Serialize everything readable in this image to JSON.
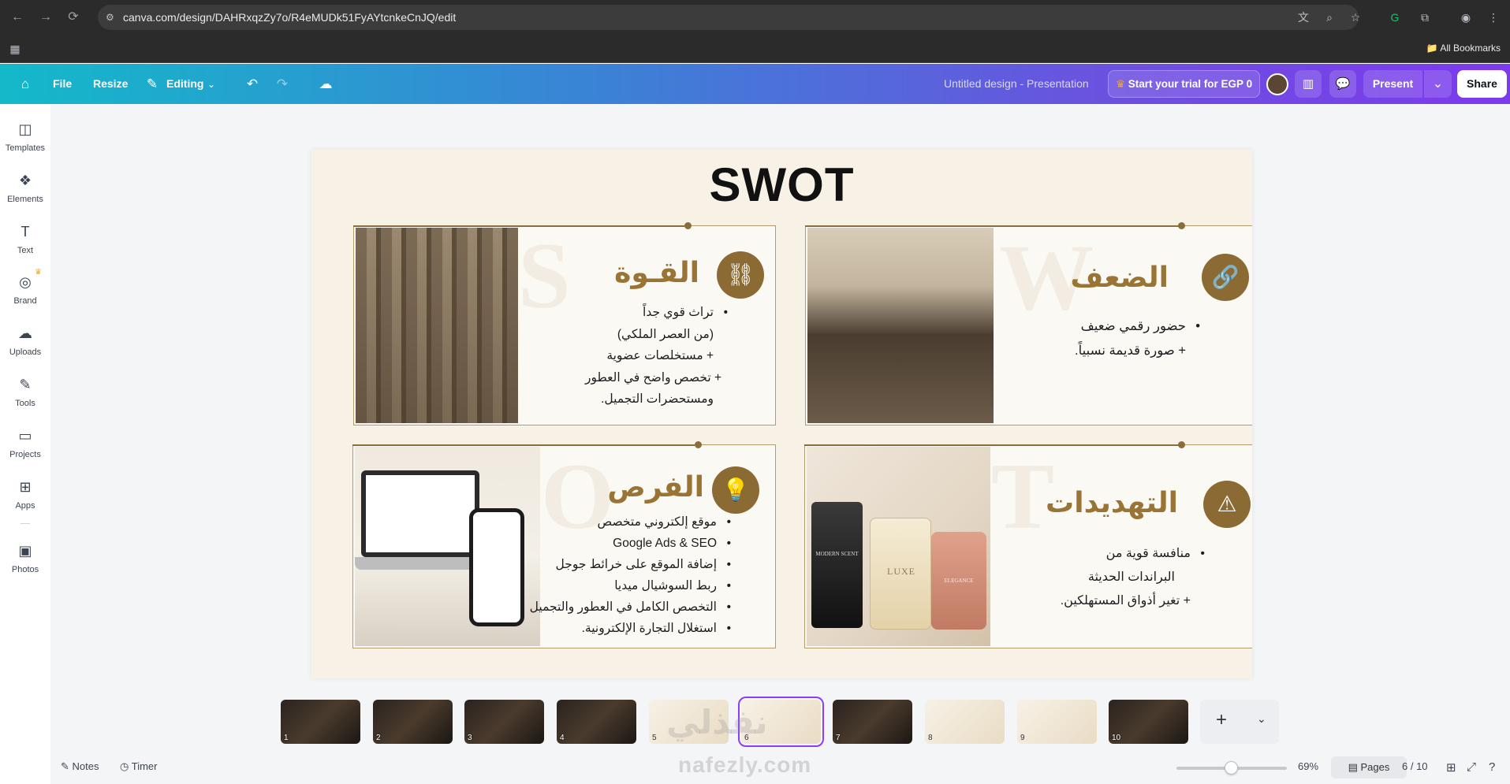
{
  "browser": {
    "url": "canva.com/design/DAHRxqzZy7o/R4eMUDk51FyAYtcnkeCnJQ/edit",
    "bookmarks_label": "All Bookmarks"
  },
  "header": {
    "file": "File",
    "resize": "Resize",
    "editing": "Editing",
    "design_title": "Untitled design - Presentation",
    "trial": "Start your trial for EGP 0",
    "present": "Present",
    "share": "Share"
  },
  "sidebar": {
    "items": [
      {
        "label": "Templates",
        "icon": "templates-icon"
      },
      {
        "label": "Elements",
        "icon": "elements-icon"
      },
      {
        "label": "Text",
        "icon": "text-icon"
      },
      {
        "label": "Brand",
        "icon": "brand-icon"
      },
      {
        "label": "Uploads",
        "icon": "uploads-icon"
      },
      {
        "label": "Tools",
        "icon": "tools-icon"
      },
      {
        "label": "Projects",
        "icon": "projects-icon"
      },
      {
        "label": "Apps",
        "icon": "apps-icon"
      },
      {
        "label": "Photos",
        "icon": "photos-icon"
      }
    ]
  },
  "slide": {
    "title": "SWOT",
    "strengths": {
      "ghost": "S",
      "heading": "القـوة",
      "lines": [
        "تراث قوي جداً",
        "(من العصر الملكي)",
        "+ مستخلصات عضوية",
        "+ تخصص واضح في العطور",
        "ومستحضرات التجميل."
      ]
    },
    "weaknesses": {
      "ghost": "W",
      "heading": "الضعف",
      "lines": [
        "حضور رقمي ضعيف",
        "+ صورة قديمة نسبياً."
      ]
    },
    "opportunities": {
      "ghost": "O",
      "heading": "الفرص",
      "lines": [
        "موقع إلكتروني متخصص",
        "Google Ads & SEO",
        "إضافة الموقع على خرائط جوجل",
        "ربط السوشيال ميديا",
        "التخصص الكامل في العطور والتجميل",
        "استغلال التجارة الإلكترونية."
      ]
    },
    "threats": {
      "ghost": "T",
      "heading": "التهديدات",
      "lines": [
        "منافسة قوية من",
        "البراندات الحديثة",
        "+ تغير أذواق المستهلكين."
      ]
    },
    "perfume_labels": {
      "left": "MODERN SCENT",
      "middle": "LUXE",
      "right": "ELEGANCE"
    }
  },
  "pages": {
    "thumbs": [
      "1",
      "2",
      "3",
      "4",
      "5",
      "6",
      "7",
      "8",
      "9",
      "10"
    ],
    "current": "6",
    "count_label": "6 / 10"
  },
  "footer": {
    "notes": "Notes",
    "timer": "Timer",
    "zoom": "69%",
    "zoom_fraction": 0.69,
    "pages": "Pages"
  },
  "watermark": {
    "en": "nafezly.com",
    "ar": "نفذلي"
  }
}
